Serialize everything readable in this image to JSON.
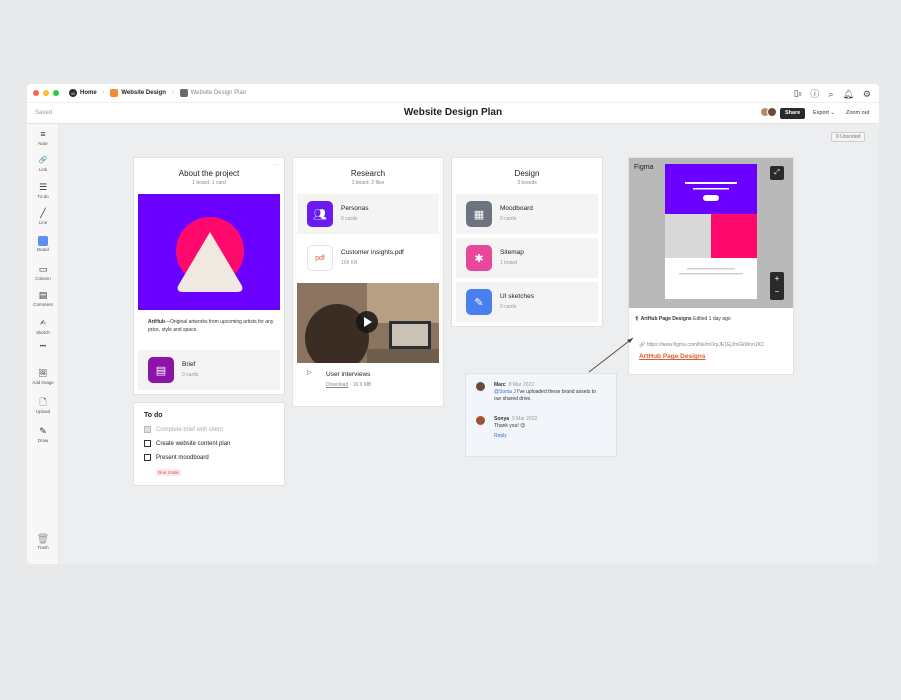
{
  "window": {
    "breadcrumb": [
      {
        "label": "Home",
        "icon": "M",
        "color": "#2b2b2b"
      },
      {
        "label": "Website Design",
        "color": "#f28c3a"
      },
      {
        "label": "Website Design Plan",
        "color": "#6b6b6b"
      }
    ],
    "notification_count": "0"
  },
  "titlebar": {
    "saved": "Saved",
    "title": "Website Design Plan",
    "share": "Share",
    "export": "Export ⌄",
    "zoom_out": "Zoom out"
  },
  "sidebar": {
    "tools": [
      {
        "label": "Note",
        "icon": "≡"
      },
      {
        "label": "Link",
        "icon": "🔗"
      },
      {
        "label": "To-do",
        "icon": "☰"
      },
      {
        "label": "Line",
        "icon": "╱"
      },
      {
        "label": "Board",
        "icon": ""
      },
      {
        "label": "Column",
        "icon": "▭"
      },
      {
        "label": "Comment",
        "icon": "▤"
      },
      {
        "label": "Sketch",
        "icon": "✍"
      },
      {
        "label": "",
        "icon": "•••"
      },
      {
        "label": "Add image",
        "icon": "🖼"
      },
      {
        "label": "Upload",
        "icon": "🗋"
      },
      {
        "label": "Draw",
        "icon": "✎"
      }
    ],
    "trash": "Trash"
  },
  "unsorted": "0 Unsorted",
  "about": {
    "title": "About the project",
    "sub": "1 board, 1 card",
    "desc_bold": "ArtHub",
    "desc_rest": "—Original artworks from upcoming artists for any price, style and space.",
    "brief_name": "Brief",
    "brief_meta": "0 cards",
    "hero_bg": "#6a00ff",
    "hero_circle": "#ff0a6c",
    "hero_triangle": "#efe9df"
  },
  "todo": {
    "title": "To do",
    "items": [
      {
        "text": "Complete brief with client",
        "done": true
      },
      {
        "text": "Create website content plan",
        "done": false
      },
      {
        "text": "Present moodboard",
        "done": false
      }
    ],
    "due": "Due 3 Mar"
  },
  "research": {
    "title": "Research",
    "sub": "1 board, 2 files",
    "personas_name": "Personas",
    "personas_meta": "0 cards",
    "pdf_name": "Customer insights.pdf",
    "pdf_meta": "168 KB",
    "pdf_label": "pdf",
    "video_name": "User interviews",
    "video_download": "Download",
    "video_size": " · 16.9 MB"
  },
  "design": {
    "title": "Design",
    "sub": "3 boards",
    "items": [
      {
        "name": "Moodboard",
        "meta": "0 cards",
        "color": "#6d7480"
      },
      {
        "name": "Sitemap",
        "meta": "1 board",
        "color": "#e8489a"
      },
      {
        "name": "UI sketches",
        "meta": "0 cards",
        "color": "#4a7ff0"
      }
    ]
  },
  "figma": {
    "label": "Figma",
    "meta_bold": "ArtHub Page Designs",
    "meta_rest": " Edited 1 day ago",
    "url": "https://www.figma.com/file/mOrpJE1EjJmGkWon1KC",
    "link": "ArtHub Page Designs"
  },
  "comments": {
    "first_name": "Marc",
    "first_date": "8 Mar 2022",
    "first_mention": "@Sonia J",
    "first_text": " I've uploaded these brand assets to our shared drive.",
    "second_name": "Sonya",
    "second_date": "9 Mar 2022",
    "second_text": "Thank you! 😊",
    "reply": "Reply"
  }
}
